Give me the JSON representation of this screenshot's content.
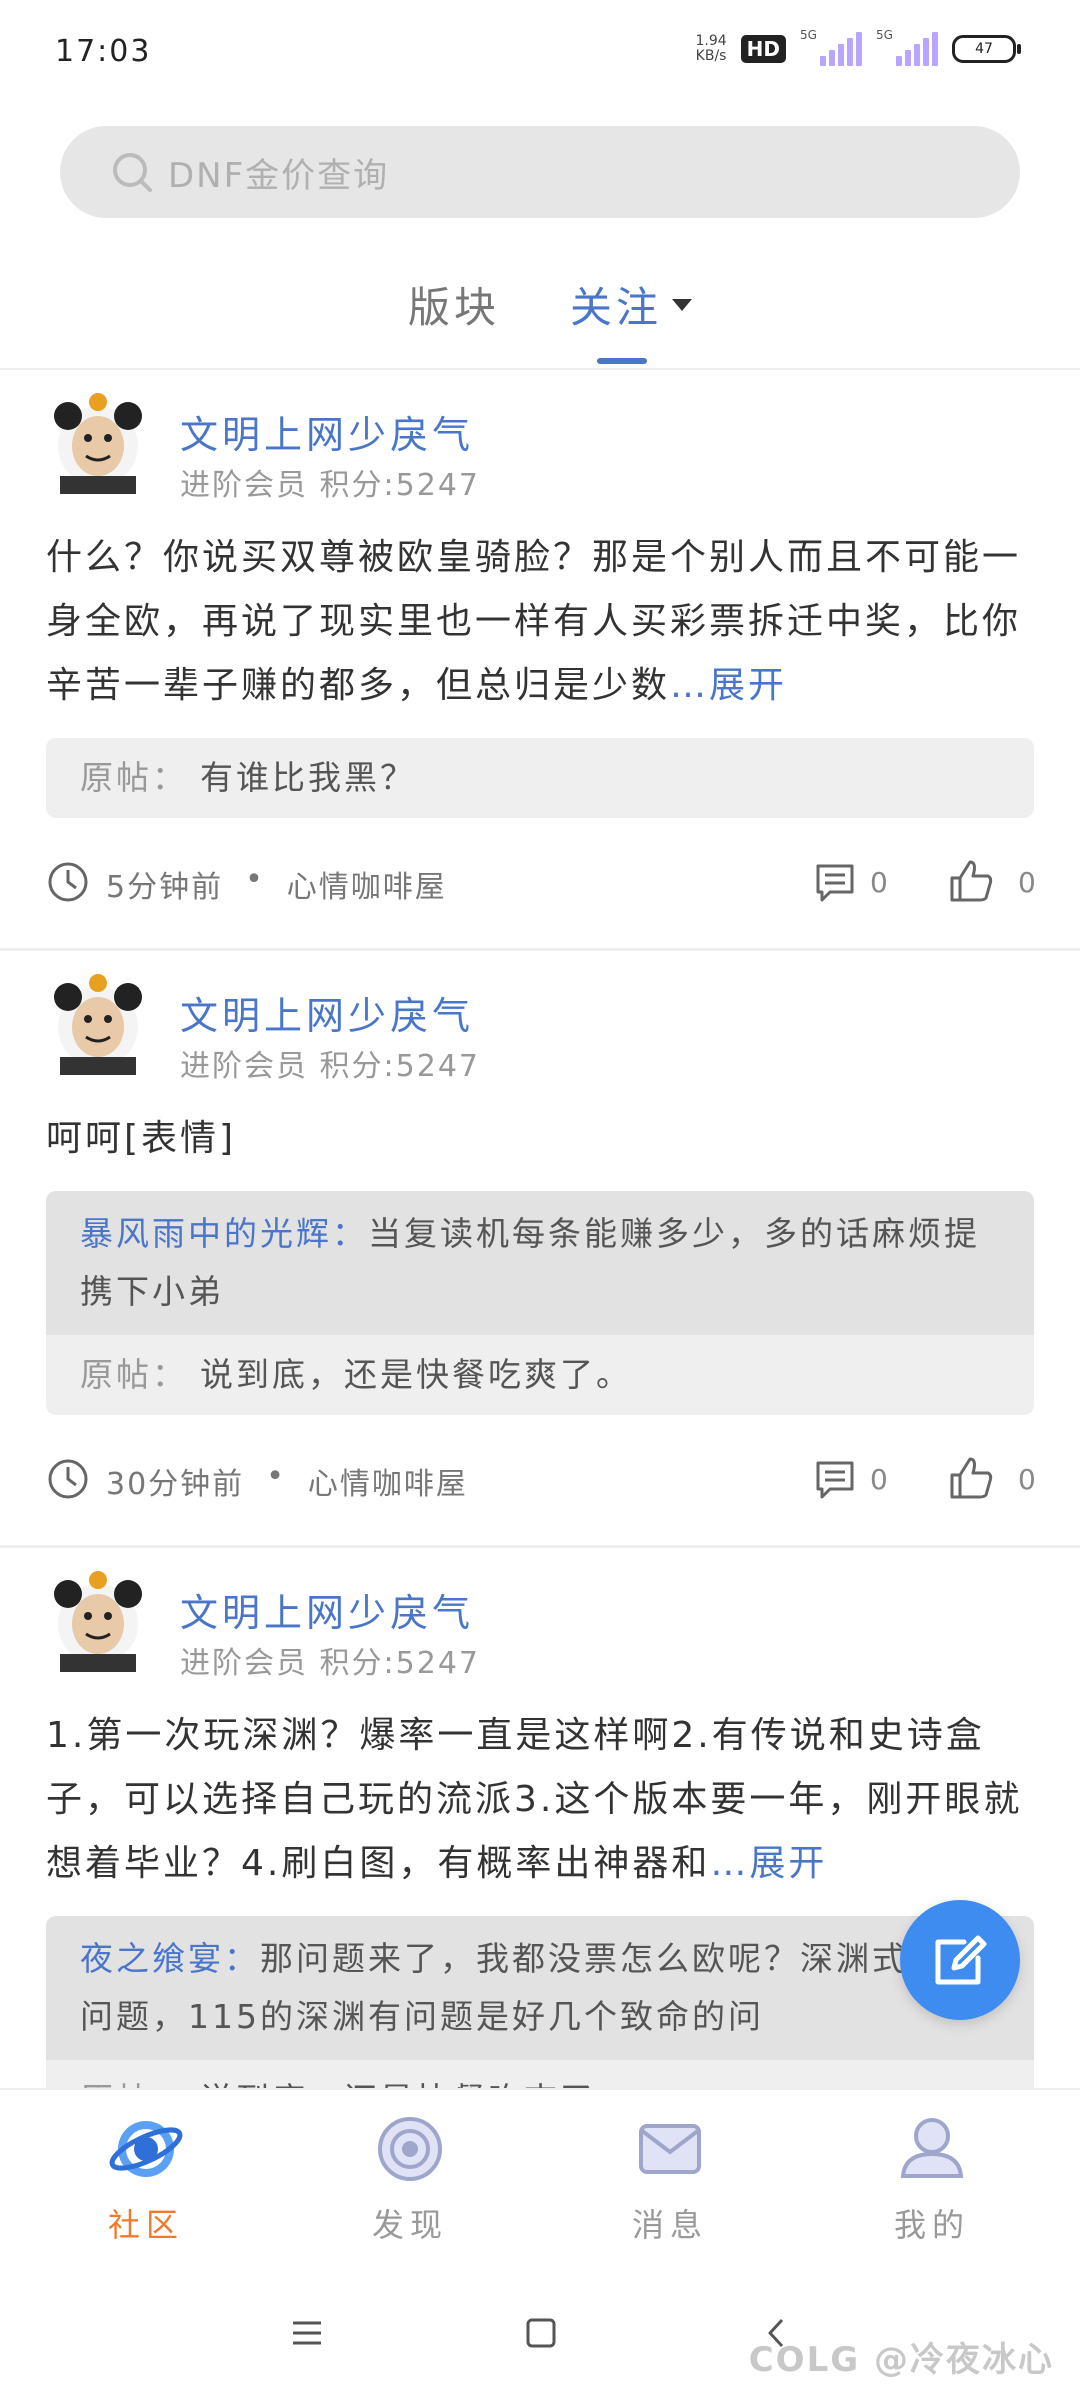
{
  "status_bar": {
    "time": "17:03",
    "net_speed_value": "1.94",
    "net_speed_unit": "KB/s",
    "hd": "HD",
    "signal1_label": "5G",
    "signal2_label": "5G",
    "battery": "47"
  },
  "search": {
    "placeholder": "DNF金价查询"
  },
  "tabs": [
    {
      "label": "版块",
      "active": false
    },
    {
      "label": "关注",
      "active": true
    }
  ],
  "posts": [
    {
      "author": "文明上网少戾气",
      "member_info": "进阶会员  积分:5247",
      "body": "什么？你说买双尊被欧皇骑脸？那是个别人而且不可能一身全欧，再说了现实里也一样有人买彩票拆迁中奖，比你辛苦一辈子赚的都多，但总归是少数",
      "expand_label": "…展开",
      "quote_reply_name": "",
      "quote_reply_text": "",
      "original_label": "原帖：",
      "original_text": "有谁比我黑？",
      "time": "5分钟前",
      "separator": "•",
      "forum": "心情咖啡屋",
      "comments": "0",
      "likes": "0"
    },
    {
      "author": "文明上网少戾气",
      "member_info": "进阶会员  积分:5247",
      "body": "呵呵[表情]",
      "expand_label": "",
      "quote_reply_name": "暴风雨中的光辉：",
      "quote_reply_text": "当复读机每条能赚多少，多的话麻烦提携下小弟",
      "original_label": "原帖：",
      "original_text": "说到底，还是快餐吃爽了。",
      "time": "30分钟前",
      "separator": "•",
      "forum": "心情咖啡屋",
      "comments": "0",
      "likes": "0"
    },
    {
      "author": "文明上网少戾气",
      "member_info": "进阶会员  积分:5247",
      "body": "1.第一次玩深渊？爆率一直是这样啊2.有传说和史诗盒子，可以选择自己玩的流派3.这个版本要一年，刚开眼就想着毕业？4.刷白图，有概率出神器和",
      "expand_label": "…展开",
      "quote_reply_name": "夜之飨宴：",
      "quote_reply_text": "那问题来了，我都没票怎么欧呢？深渊式不是问题，115的深渊有问题是好几个致命的问",
      "original_label": "原帖：",
      "original_text": "说到底，还是快餐吃爽了。",
      "time": "",
      "separator": "",
      "forum": "",
      "comments": "",
      "likes": ""
    }
  ],
  "bottom_nav": [
    {
      "label": "社区",
      "icon": "community-icon",
      "active": true
    },
    {
      "label": "发现",
      "icon": "discover-icon",
      "active": false
    },
    {
      "label": "消息",
      "icon": "message-icon",
      "active": false
    },
    {
      "label": "我的",
      "icon": "profile-icon",
      "active": false
    }
  ],
  "watermark": "COLG @冷夜冰心",
  "colors": {
    "accent": "#4a76c9",
    "active_nav": "#ef7a2c",
    "fab": "#3f8cf0"
  }
}
